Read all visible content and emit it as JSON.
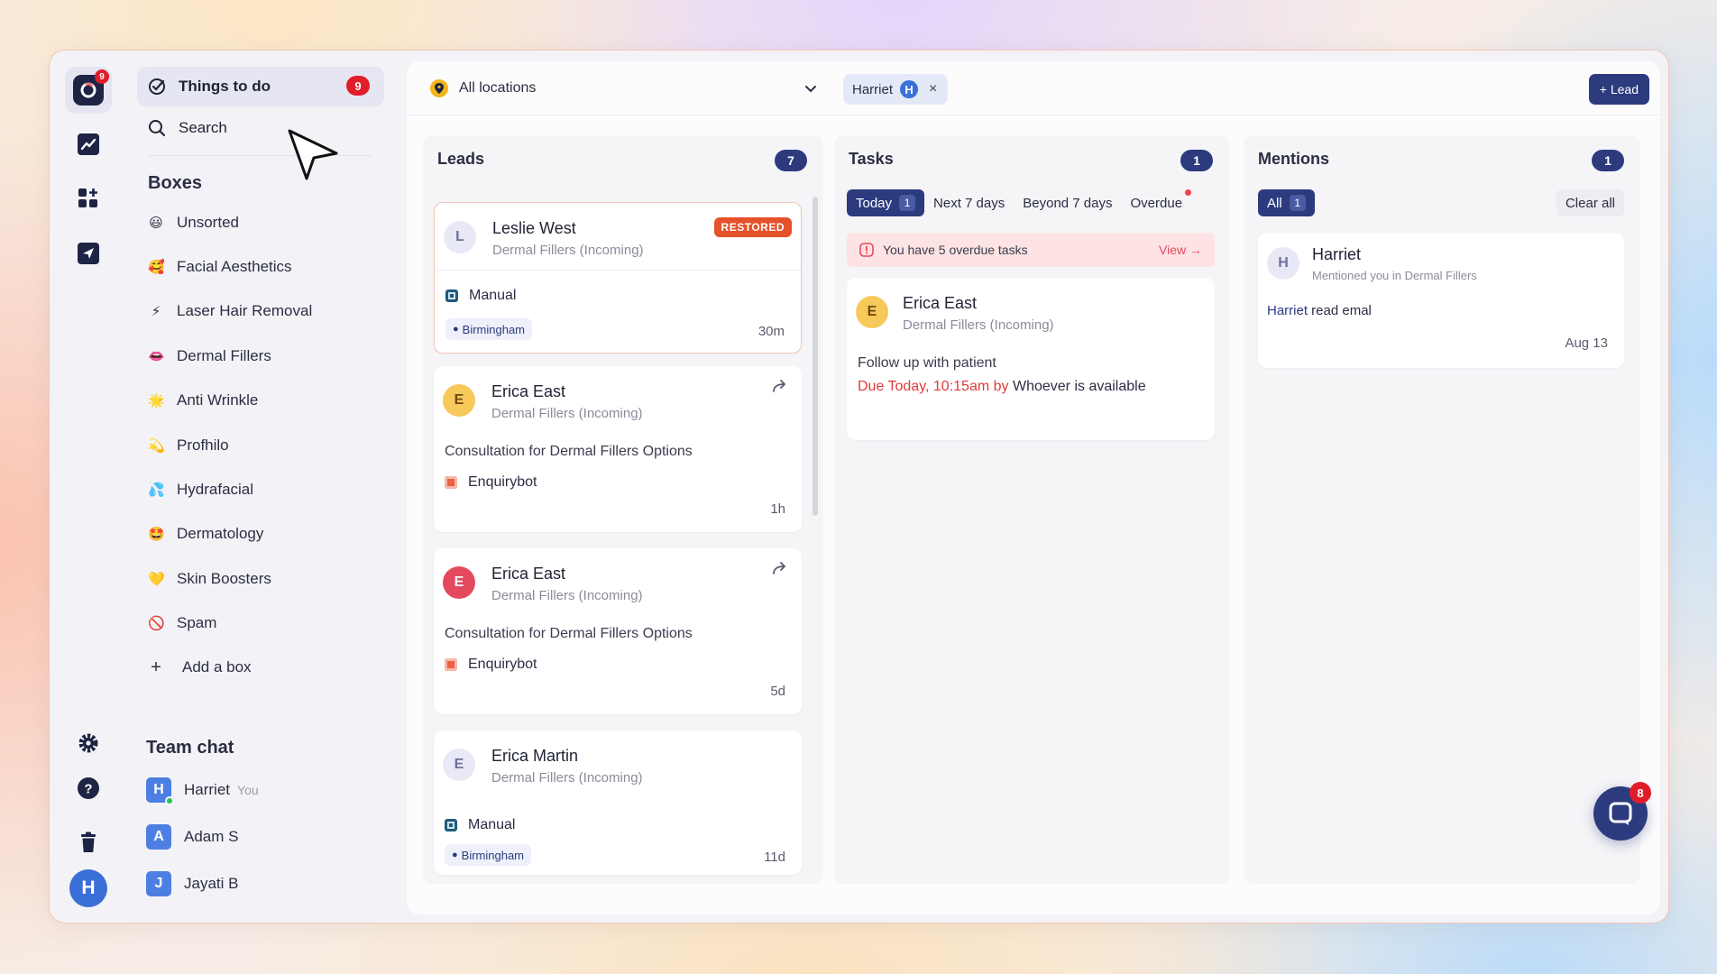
{
  "rail": {
    "logo_badge": "9",
    "avatar": "H"
  },
  "sidebar": {
    "things_to_do": {
      "label": "Things to do",
      "count": "9"
    },
    "search": {
      "label": "Search"
    },
    "boxes_title": "Boxes",
    "boxes": [
      {
        "emoji": "😃",
        "label": "Unsorted"
      },
      {
        "emoji": "🥰",
        "label": "Facial Aesthetics"
      },
      {
        "emoji": "⚡",
        "label": "Laser Hair Removal"
      },
      {
        "emoji": "👄",
        "label": "Dermal Fillers"
      },
      {
        "emoji": "🌟",
        "label": "Anti Wrinkle"
      },
      {
        "emoji": "💫",
        "label": "Profhilo"
      },
      {
        "emoji": "💦",
        "label": "Hydrafacial"
      },
      {
        "emoji": "🤩",
        "label": "Dermatology"
      },
      {
        "emoji": "💛",
        "label": "Skin Boosters"
      },
      {
        "emoji": "🚫",
        "label": "Spam"
      }
    ],
    "add_box": "Add a box",
    "team_chat_title": "Team chat",
    "team": [
      {
        "initial": "H",
        "name": "Harriet",
        "note": "You"
      },
      {
        "initial": "A",
        "name": "Adam S",
        "note": ""
      },
      {
        "initial": "J",
        "name": "Jayati B",
        "note": ""
      }
    ]
  },
  "topbar": {
    "location": "All locations",
    "filter_name": "Harriet",
    "filter_initial": "H",
    "filter_close": "×",
    "add_lead": "+ Lead"
  },
  "leads": {
    "title": "Leads",
    "count": "7",
    "cards": [
      {
        "initial": "L",
        "name": "Leslie West",
        "sub": "Dermal Fillers (Incoming)",
        "badge": "RESTORED",
        "source": "Manual",
        "location": "Birmingham",
        "time": "30m"
      },
      {
        "initial": "E",
        "name": "Erica East",
        "sub": "Dermal Fillers (Incoming)",
        "desc": "Consultation for Dermal Fillers Options",
        "source": "Enquirybot",
        "time": "1h"
      },
      {
        "initial": "E",
        "name": "Erica East",
        "sub": "Dermal Fillers (Incoming)",
        "desc": "Consultation for Dermal Fillers Options",
        "source": "Enquirybot",
        "time": "5d"
      },
      {
        "initial": "E",
        "name": "Erica Martin",
        "sub": "Dermal Fillers (Incoming)",
        "source": "Manual",
        "location": "Birmingham",
        "time": "11d"
      }
    ]
  },
  "tasks": {
    "title": "Tasks",
    "count": "1",
    "tabs": [
      {
        "label": "Today",
        "count": "1"
      },
      {
        "label": "Next 7 days"
      },
      {
        "label": "Beyond 7 days"
      },
      {
        "label": "Overdue"
      }
    ],
    "overdue_text": "You have 5 overdue tasks",
    "overdue_view": "View →",
    "card": {
      "initial": "E",
      "name": "Erica East",
      "sub": "Dermal Fillers (Incoming)",
      "task": "Follow up with patient",
      "due": "Due Today, 10:15am by",
      "who": "Whoever is available"
    }
  },
  "mentions": {
    "title": "Mentions",
    "count": "1",
    "tab_all": "All",
    "tab_all_count": "1",
    "clear_all": "Clear all",
    "card": {
      "initial": "H",
      "name": "Harriet",
      "sub": "Mentioned you in Dermal Fillers",
      "text_highlight": "Harriet",
      "text_rest": " read emal",
      "date": "Aug 13"
    }
  },
  "chat_fab": {
    "count": "8"
  }
}
